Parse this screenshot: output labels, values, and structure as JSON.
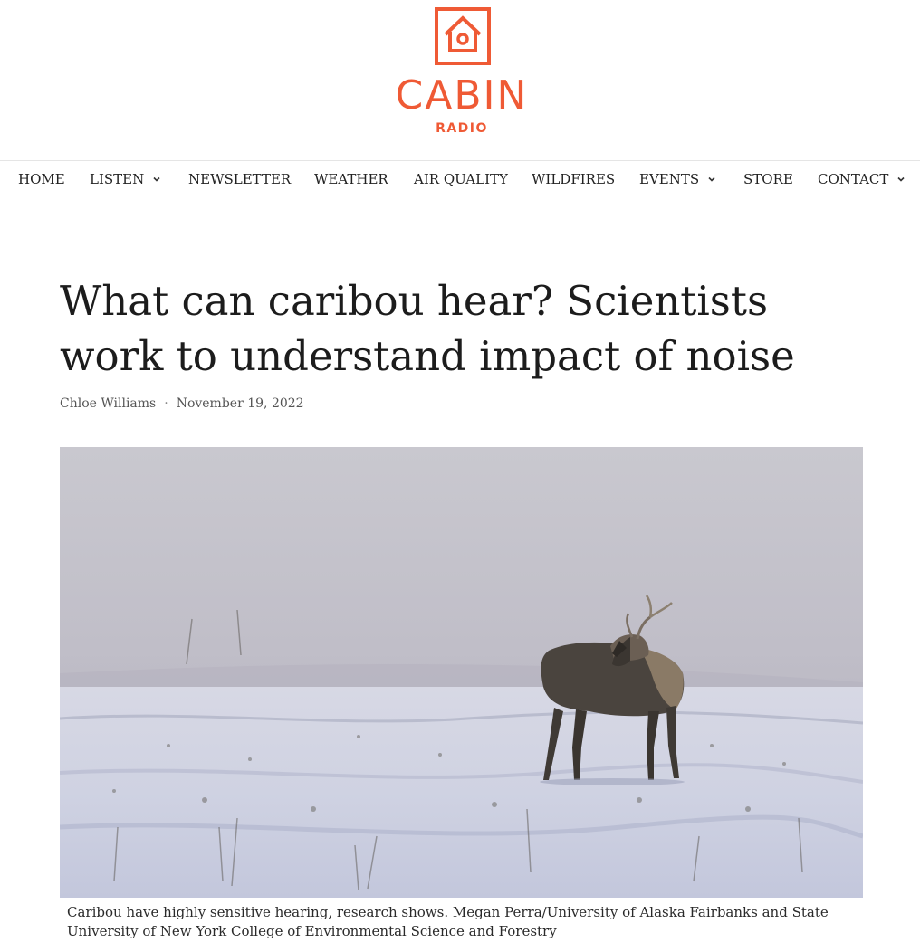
{
  "site": {
    "name": "CABIN",
    "sub": "RADIO",
    "brand_color": "#ef5a35"
  },
  "nav": {
    "items": [
      {
        "label": "HOME",
        "has_dropdown": false
      },
      {
        "label": "LISTEN",
        "has_dropdown": true
      },
      {
        "label": "NEWSLETTER",
        "has_dropdown": false
      },
      {
        "label": "WEATHER",
        "has_dropdown": false
      },
      {
        "label": "AIR QUALITY",
        "has_dropdown": false
      },
      {
        "label": "WILDFIRES",
        "has_dropdown": false
      },
      {
        "label": "EVENTS",
        "has_dropdown": true
      },
      {
        "label": "STORE",
        "has_dropdown": false
      },
      {
        "label": "CONTACT",
        "has_dropdown": true
      }
    ]
  },
  "article": {
    "title": "What can caribou hear? Scientists work to understand impact of noise",
    "author": "Chloe Williams",
    "separator": "·",
    "date": "November 19, 2022",
    "image_caption": "Caribou have highly sensitive hearing, research shows. Megan Perra/University of Alaska Fairbanks and State University of New York College of Environmental Science and Forestry"
  },
  "icons": {
    "logo": "cabin-house-icon",
    "dropdown": "chevron-down-icon"
  }
}
